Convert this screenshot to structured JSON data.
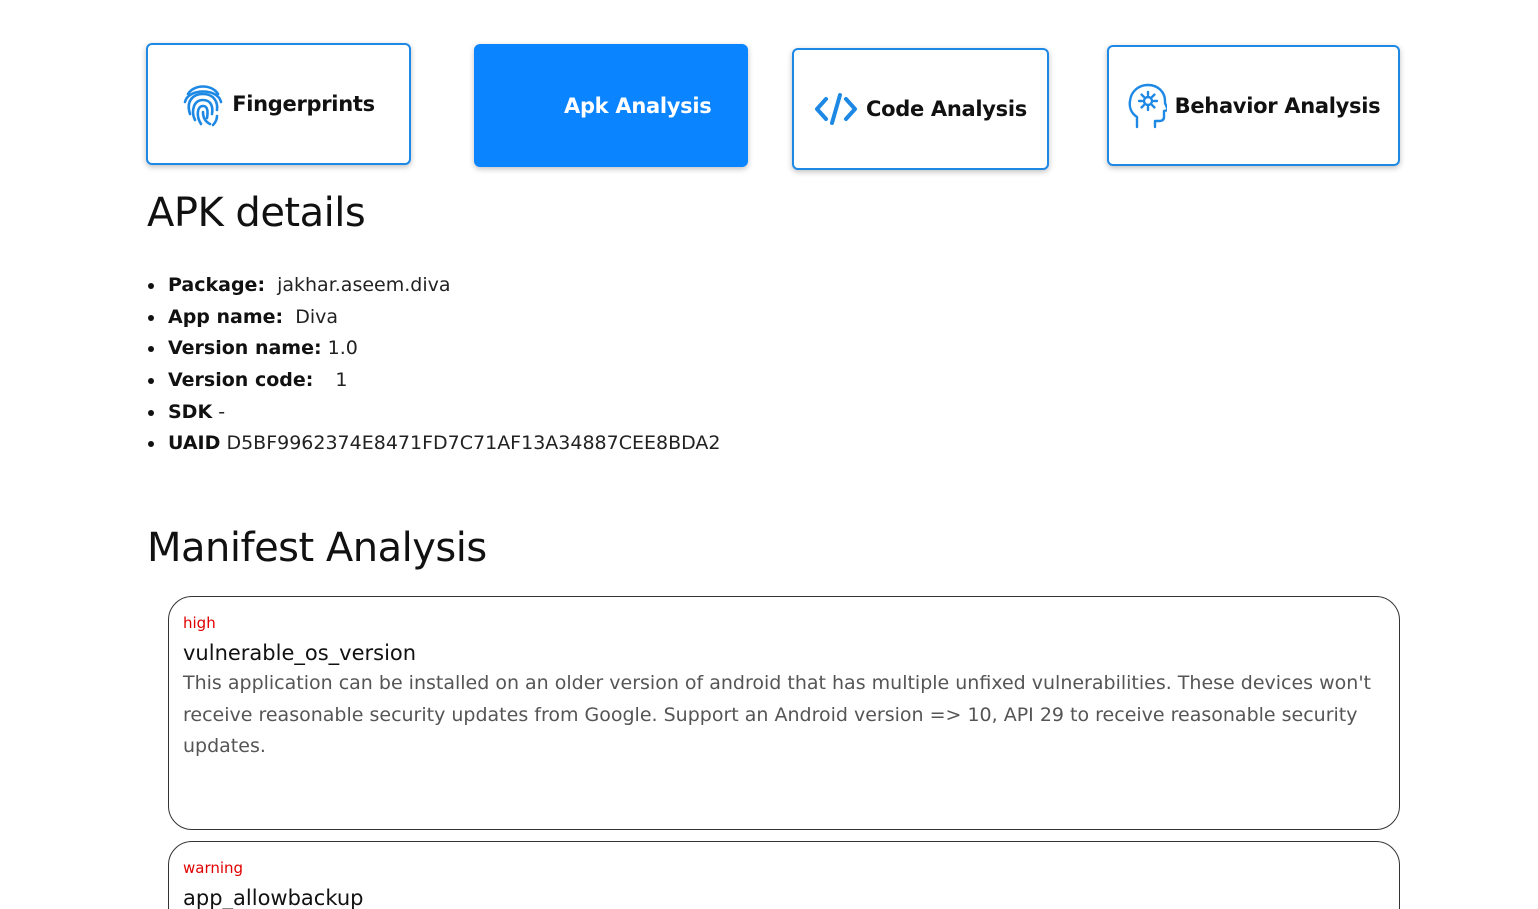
{
  "tabs": [
    {
      "label": "Fingerprints",
      "icon": "fingerprint-icon",
      "active": false
    },
    {
      "label": "Apk Analysis",
      "icon": "",
      "active": true
    },
    {
      "label": "Code Analysis",
      "icon": "code-icon",
      "active": false
    },
    {
      "label": "Behavior Analysis",
      "icon": "head-gear-icon",
      "active": false
    }
  ],
  "colors": {
    "accent": "#0a84ff",
    "tab_border": "#1e88e5",
    "severity": "#e00000"
  },
  "apk_details": {
    "title": "APK details",
    "items": [
      {
        "key": "Package:",
        "value": "jakhar.aseem.diva"
      },
      {
        "key": "App name:",
        "value": "Diva"
      },
      {
        "key": "Version name:",
        "value": "1.0"
      },
      {
        "key": "Version code:",
        "value": "1"
      },
      {
        "key": "SDK",
        "value": "-"
      },
      {
        "key": "UAID",
        "value": "D5BF9962374E8471FD7C71AF13A34887CEE8BDA2"
      }
    ]
  },
  "manifest": {
    "title": "Manifest Analysis",
    "findings": [
      {
        "severity": "high",
        "title": "vulnerable_os_version",
        "description": "This application can be installed on an older version of android that has multiple unfixed vulnerabilities. These devices won't receive reasonable security updates from Google. Support an Android version => 10, API 29 to receive reasonable security updates."
      },
      {
        "severity": "warning",
        "title": "app_allowbackup",
        "description": ""
      }
    ]
  }
}
